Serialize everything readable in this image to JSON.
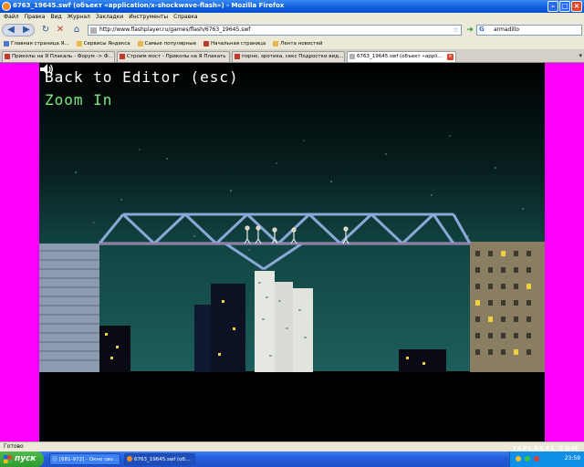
{
  "window": {
    "title": "6763_19645.swf (объект «application/x-shockwave-flash») - Mozilla Firefox"
  },
  "menu": {
    "items": [
      "Файл",
      "Правка",
      "Вид",
      "Журнал",
      "Закладки",
      "Инструменты",
      "Справка"
    ]
  },
  "nav": {
    "url": "http://www.flashplayer.ru/games/flash/6763_19645.swf",
    "search_value": "armadillo"
  },
  "bookmarks": {
    "items": [
      "Главная страница Я...",
      "Сервисы Яндекса",
      "Самые популярные",
      "Начальная страница",
      "Лента новостей"
    ]
  },
  "tabs": {
    "items": [
      "Приколы на Я Плакаль - Форум -> Ф...",
      "Строим мост - Приколы на Я Плакать",
      "порно, эротика, секс Подростки вид...",
      "6763_19645.swf (объект «appli..."
    ]
  },
  "game": {
    "back_label": "Back to Editor (esc)",
    "zoom_label": "Zoom In",
    "colors": {
      "sky": "#1a5a58",
      "text_zoom": "#7fe87f",
      "bridge": "#8aa8d8"
    }
  },
  "status": {
    "text": "Готово"
  },
  "taskbar": {
    "start_label": "пуск",
    "items": [
      "[681-972] - Окно сво...",
      "6763_19645.swf (об..."
    ],
    "clock": "23:59",
    "watermark": "YAPLAKAL.COM"
  }
}
